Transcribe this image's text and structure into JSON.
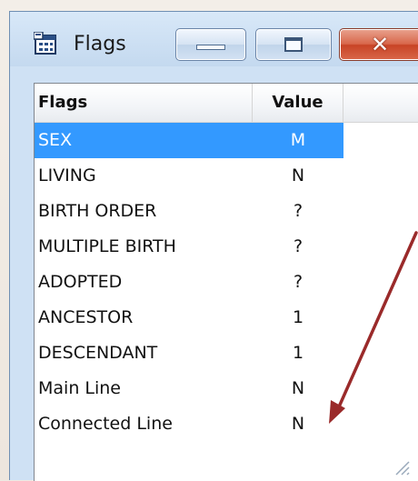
{
  "window": {
    "title": "Flags",
    "buttons": {
      "minimize": "minimize",
      "maximize": "maximize",
      "close": "close"
    }
  },
  "list": {
    "columns": [
      "Flags",
      "Value"
    ],
    "rows": [
      {
        "flag": "SEX",
        "value": "M",
        "selected": true
      },
      {
        "flag": "LIVING",
        "value": "N"
      },
      {
        "flag": "BIRTH ORDER",
        "value": "?"
      },
      {
        "flag": "MULTIPLE BIRTH",
        "value": "?"
      },
      {
        "flag": "ADOPTED",
        "value": "?"
      },
      {
        "flag": "ANCESTOR",
        "value": "1"
      },
      {
        "flag": "DESCENDANT",
        "value": "1"
      },
      {
        "flag": "Main Line",
        "value": "N"
      },
      {
        "flag": "Connected Line",
        "value": "N"
      }
    ]
  },
  "colors": {
    "selection": "#3399ff",
    "arrow": "#9a2a2a",
    "close_button": "#c84426"
  }
}
